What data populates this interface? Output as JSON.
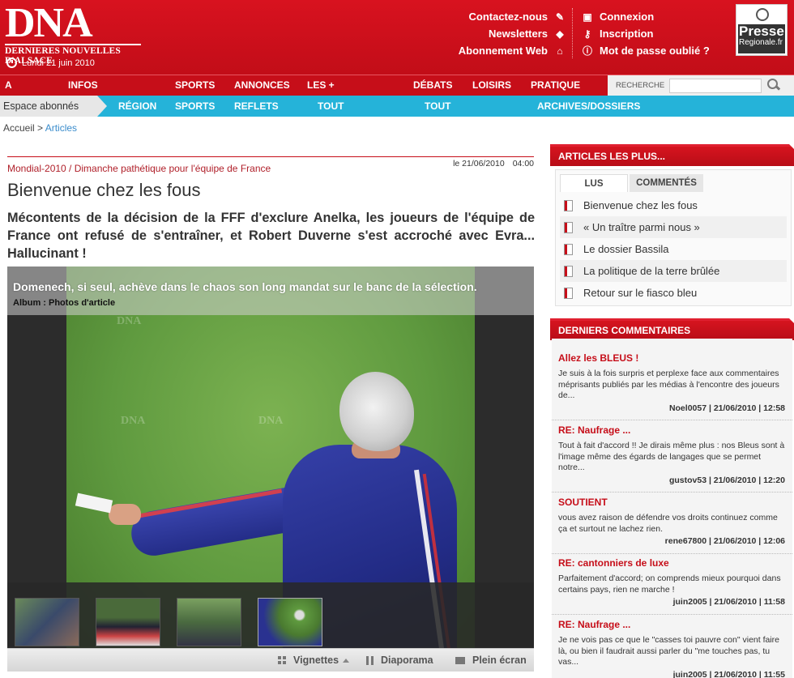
{
  "header": {
    "logo_main": "DNA",
    "logo_sub": "DERNIERES NOUVELLES D'ALSACE",
    "date": "Lundi 21 juin 2010",
    "links_left": [
      "Contactez-nous",
      "Newsletters",
      "Abonnement Web"
    ],
    "links_right": [
      "Connexion",
      "Inscription",
      "Mot de passe oublié ?"
    ],
    "presse_title": "Presse",
    "presse_sub": "Regionale.fr"
  },
  "nav1": {
    "items": [
      "A LA UNE",
      "INFOS GÉNÉRALES",
      "SPORTS",
      "ANNONCES",
      "LES + MULTIMÉDIA",
      "DÉBATS",
      "LOISIRS",
      "PRATIQUE"
    ],
    "search_label": "RECHERCHE",
    "search_value": ""
  },
  "nav2": {
    "espace": "Espace abonnés",
    "items": [
      "RÉGION",
      "SPORTS",
      "REFLETS DNA",
      "TOUT LE BAS-RHIN",
      "TOUT LE HAUT-RHIN",
      "ARCHIVES/DOSSIERS"
    ]
  },
  "breadcrumb": {
    "home": "Accueil",
    "sep": " > ",
    "current": "Articles"
  },
  "article": {
    "date": "le 21/06/2010",
    "time": "04:00",
    "category": "Mondial-2010 / Dimanche pathétique pour l'équipe de France",
    "title": "Bienvenue chez les fous",
    "lead": "Mécontents de la décision de la FFF d'exclure Anelka, les joueurs de l'équipe de France ont refusé de s'entraîner, et Robert Duverne s'est accroché avec Evra... Hallucinant !",
    "photo_caption": "Domenech, si seul, achève dans le chaos son long mandat sur le banc de la sélection.",
    "photo_album": "Album : Photos d'article",
    "watermark": "DNA",
    "toolbar": [
      "Vignettes",
      "Diaporama",
      "Plein écran"
    ]
  },
  "sidebar": {
    "plus_title": "ARTICLES LES PLUS...",
    "tabs": [
      "LUS",
      "COMMENTÉS"
    ],
    "plus_items": [
      "Bienvenue chez les fous",
      "« Un traître parmi nous »",
      "Le dossier Bassila",
      "La politique de la terre brûlée",
      "Retour sur le fiasco bleu"
    ],
    "comments_title": "DERNIERS COMMENTAIRES",
    "comments": [
      {
        "title": "Allez les BLEUS !",
        "text": "Je suis à la fois surpris et perplexe face aux commentaires méprisants publiés par les médias à l'encontre des joueurs de...",
        "meta": "Noel0057 | 21/06/2010 | 12:58"
      },
      {
        "title": "RE: Naufrage ...",
        "text": "Tout à fait d'accord !! Je dirais même plus : nos Bleus sont à l'image même des égards de langages que se permet notre...",
        "meta": "gustov53 | 21/06/2010 | 12:20"
      },
      {
        "title": "SOUTIENT",
        "text": "vous avez raison de défendre vos droits continuez comme ça et surtout ne lachez rien.",
        "meta": "rene67800 | 21/06/2010 | 12:06"
      },
      {
        "title": "RE: cantonniers de luxe",
        "text": "Parfaitement d'accord; on comprends mieux pourquoi dans certains pays, rien ne marche !",
        "meta": "juin2005 | 21/06/2010 | 11:58"
      },
      {
        "title": "RE: Naufrage ...",
        "text": "Je ne vois pas ce que le \"casses toi pauvre con\" vient faire là, ou bien il faudrait aussi parler du \"me touches pas, tu vas...",
        "meta": "juin2005 | 21/06/2010 | 11:55"
      }
    ]
  },
  "colors": {
    "brand_red": "#c60e19",
    "nav_blue": "#25b3d9"
  }
}
